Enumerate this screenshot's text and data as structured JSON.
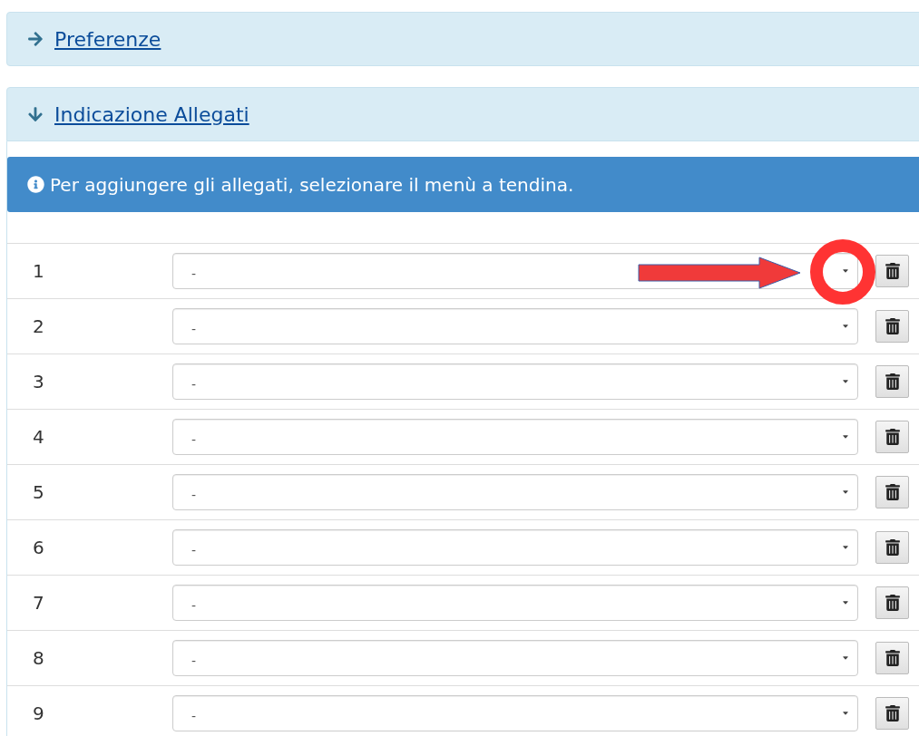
{
  "panels": [
    {
      "title": "Preferenze",
      "expanded": false
    },
    {
      "title": "Indicazione Allegati",
      "expanded": true
    }
  ],
  "info": "Per aggiungere gli allegati, selezionare il menù a tendina.",
  "rows": [
    {
      "number": "1",
      "value": "-"
    },
    {
      "number": "2",
      "value": "-"
    },
    {
      "number": "3",
      "value": "-"
    },
    {
      "number": "4",
      "value": "-"
    },
    {
      "number": "5",
      "value": "-"
    },
    {
      "number": "6",
      "value": "-"
    },
    {
      "number": "7",
      "value": "-"
    },
    {
      "number": "8",
      "value": "-"
    },
    {
      "number": "9",
      "value": "-"
    }
  ]
}
